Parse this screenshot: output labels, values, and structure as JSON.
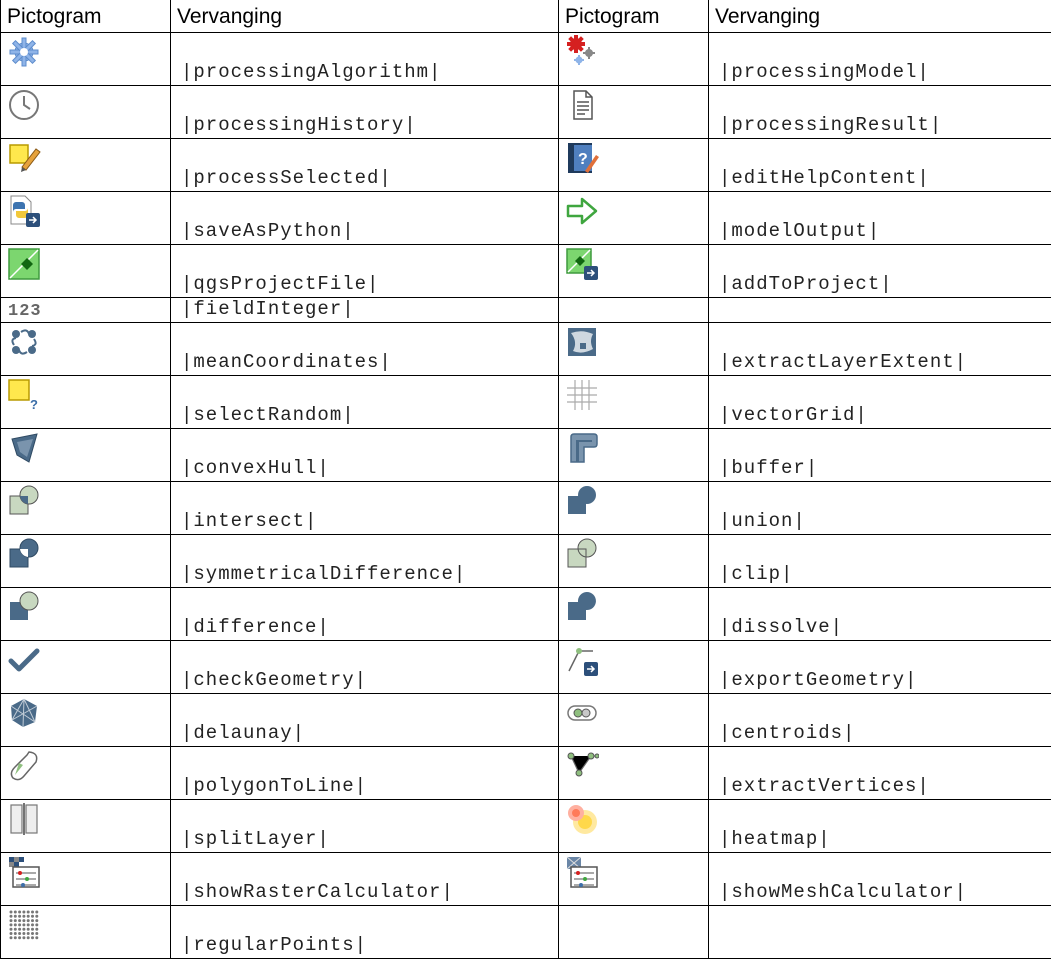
{
  "header": {
    "col1": "Pictogram",
    "col2": "Vervanging",
    "col3": "Pictogram",
    "col4": "Vervanging"
  },
  "rows": [
    {
      "left": {
        "icon": "gear-icon",
        "text": "|processingAlgorithm|"
      },
      "right": {
        "icon": "gears-model-icon",
        "text": "|processingModel|"
      }
    },
    {
      "left": {
        "icon": "clock-icon",
        "text": "|processingHistory|"
      },
      "right": {
        "icon": "document-icon",
        "text": "|processingResult|"
      }
    },
    {
      "left": {
        "icon": "edit-selected-icon",
        "text": "|processSelected|"
      },
      "right": {
        "icon": "help-book-edit-icon",
        "text": "|editHelpContent|"
      }
    },
    {
      "left": {
        "icon": "python-file-icon",
        "text": "|saveAsPython|"
      },
      "right": {
        "icon": "green-arrow-right-icon",
        "text": "|modelOutput|"
      }
    },
    {
      "left": {
        "icon": "qgis-project-icon",
        "text": "|qgsProjectFile|"
      },
      "right": {
        "icon": "add-to-project-icon",
        "text": "|addToProject|"
      }
    },
    {
      "left": {
        "icon": "integer-field-icon",
        "text": "|fieldInteger|"
      },
      "right": {
        "icon": "",
        "text": ""
      }
    },
    {
      "left": {
        "icon": "mean-coordinates-icon",
        "text": "|meanCoordinates|"
      },
      "right": {
        "icon": "layer-extent-icon",
        "text": "|extractLayerExtent|"
      }
    },
    {
      "left": {
        "icon": "select-random-icon",
        "text": "|selectRandom|"
      },
      "right": {
        "icon": "grid-icon",
        "text": "|vectorGrid|"
      }
    },
    {
      "left": {
        "icon": "convex-hull-icon",
        "text": "|convexHull|"
      },
      "right": {
        "icon": "buffer-icon",
        "text": "|buffer|"
      }
    },
    {
      "left": {
        "icon": "intersect-icon",
        "text": "|intersect|"
      },
      "right": {
        "icon": "union-icon",
        "text": "|union|"
      }
    },
    {
      "left": {
        "icon": "symmetrical-difference-icon",
        "text": "|symmetricalDifference|"
      },
      "right": {
        "icon": "clip-icon",
        "text": "|clip|"
      }
    },
    {
      "left": {
        "icon": "difference-icon",
        "text": "|difference|"
      },
      "right": {
        "icon": "dissolve-icon",
        "text": "|dissolve|"
      }
    },
    {
      "left": {
        "icon": "checkmark-icon",
        "text": "|checkGeometry|"
      },
      "right": {
        "icon": "export-geometry-icon",
        "text": "|exportGeometry|"
      }
    },
    {
      "left": {
        "icon": "delaunay-icon",
        "text": "|delaunay|"
      },
      "right": {
        "icon": "centroids-icon",
        "text": "|centroids|"
      }
    },
    {
      "left": {
        "icon": "polygon-to-line-icon",
        "text": "|polygonToLine|"
      },
      "right": {
        "icon": "extract-vertices-icon",
        "text": "|extractVertices|"
      }
    },
    {
      "left": {
        "icon": "split-layer-icon",
        "text": "|splitLayer|"
      },
      "right": {
        "icon": "heatmap-icon",
        "text": "|heatmap|"
      }
    },
    {
      "left": {
        "icon": "raster-calculator-icon",
        "text": "|showRasterCalculator|"
      },
      "right": {
        "icon": "mesh-calculator-icon",
        "text": "|showMeshCalculator|"
      }
    },
    {
      "left": {
        "icon": "regular-points-icon",
        "text": "|regularPoints|"
      },
      "right": {
        "icon": "",
        "text": ""
      }
    }
  ]
}
